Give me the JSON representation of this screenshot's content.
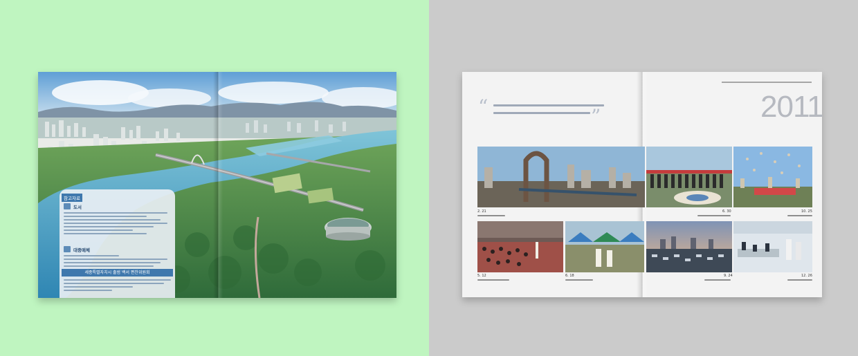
{
  "left_book": {
    "infobox": {
      "tag": "참고자료",
      "section1": "도서",
      "section2": "대중매체",
      "band": "세종특별자치시 출범 백서 편찬위원회"
    }
  },
  "right_book": {
    "year": "2011",
    "photos": [
      {
        "date": "2. 21"
      },
      {
        "date": "6. 30"
      },
      {
        "date": "10. 25"
      },
      {
        "date": "5. 12"
      },
      {
        "date": "6. 18"
      },
      {
        "date": "9. 24"
      },
      {
        "date": "12. 26"
      }
    ]
  },
  "colors": {
    "left_background": "#bff5c0",
    "right_background": "#cbcbcb",
    "accent_blue": "#3f78ad"
  }
}
